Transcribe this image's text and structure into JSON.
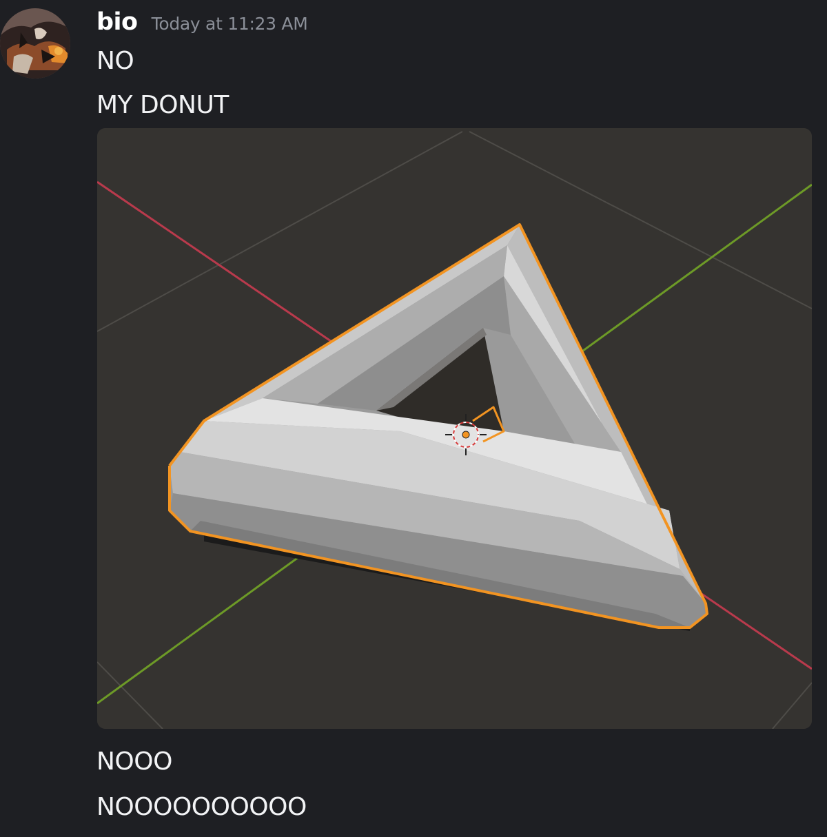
{
  "message": {
    "author": "bio",
    "timestamp": "Today at 11:23 AM",
    "lines_before_image": [
      "NO",
      "MY DONUT"
    ],
    "lines_after_image": [
      "NOOO",
      "NOOOOOOOOOO"
    ]
  },
  "avatar": {
    "icon": "user-avatar"
  },
  "attachment": {
    "icon": "blender-viewport-screenshot",
    "colors": {
      "viewport_bg": "#353330",
      "x_axis": "#b93a4c",
      "y_axis": "#6d9a27",
      "grid": "#4e4c48",
      "selection_outline": "#f29422"
    }
  },
  "colors": {
    "background": "#1e1f23",
    "text": "#f2f3f5",
    "timestamp": "#8b8f98"
  }
}
